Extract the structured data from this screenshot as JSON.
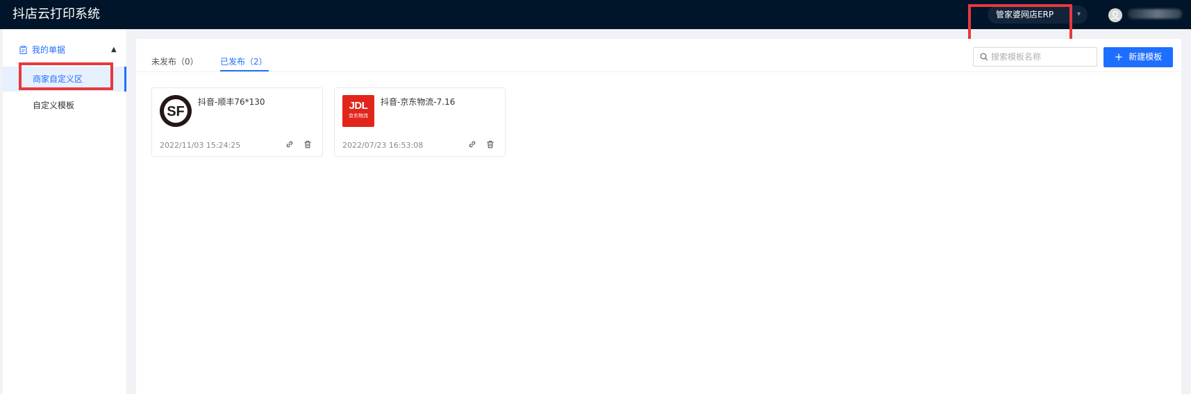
{
  "header": {
    "app_title": "抖店云打印系统",
    "org_select_value": "管家婆网店ERP"
  },
  "sidebar": {
    "group_label": "我的单据",
    "items": [
      {
        "label": "商家自定义区",
        "active": true
      },
      {
        "label": "自定义模板",
        "active": false
      }
    ]
  },
  "tabs": [
    {
      "label": "未发布（0）",
      "active": false
    },
    {
      "label": "已发布（2）",
      "active": true
    }
  ],
  "search": {
    "placeholder": "搜索模板名称",
    "value": ""
  },
  "new_button_label": "新建模板",
  "templates": [
    {
      "title": "抖音-顺丰76*130",
      "date": "2022/11/03 15:24:25",
      "logo": "SF",
      "logo_color": "#231815"
    },
    {
      "title": "抖音-京东物流-7.16",
      "date": "2022/07/23 16:53:08",
      "logo": "JDL",
      "logo_sub": "京东物流",
      "logo_color": "#e1251b"
    }
  ],
  "colors": {
    "header_bg": "#001529",
    "accent": "#1e6fff",
    "highlight": "#e8383d"
  }
}
